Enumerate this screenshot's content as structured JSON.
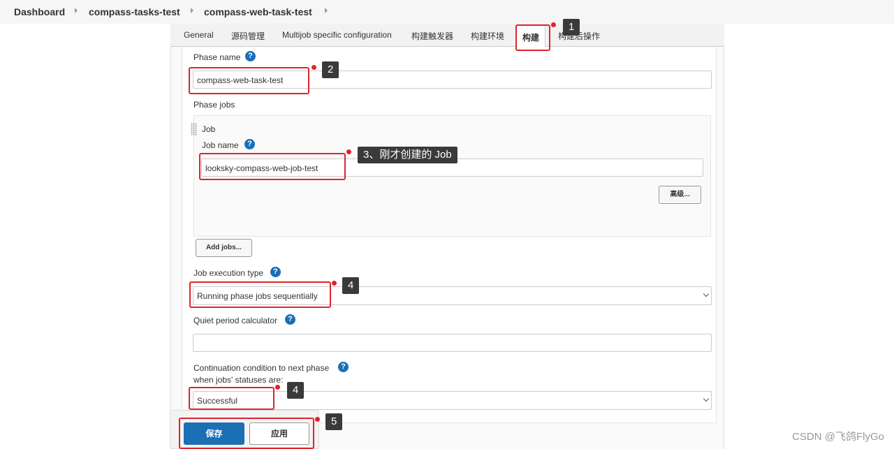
{
  "breadcrumb": [
    "Dashboard",
    "compass-tasks-test",
    "compass-web-task-test"
  ],
  "tabs": [
    "General",
    "源码管理",
    "Multijob specific configuration",
    "构建触发器",
    "构建环境",
    "构建",
    "构建后操作"
  ],
  "active_tab": "构建",
  "form": {
    "phase_name_label": "Phase name",
    "phase_name_value": "compass-web-task-test",
    "phase_jobs_label": "Phase jobs",
    "job_header": "Job",
    "job_name_label": "Job name",
    "job_name_value": "looksky-compass-web-job-test",
    "advanced_button": "高级...",
    "add_jobs_button": "Add jobs...",
    "exec_type_label": "Job execution type",
    "exec_type_value": "Running phase jobs sequentially",
    "quiet_period_label": "Quiet period calculator",
    "quiet_period_value": "",
    "continuation_label_line1": "Continuation condition to next phase",
    "continuation_label_line2": "when jobs' statuses are:",
    "continuation_value": "Successful",
    "help_glyph": "?"
  },
  "buttons": {
    "save": "保存",
    "apply": "应用"
  },
  "callouts": [
    "1",
    "2",
    "3、刚才创建的 Job",
    "4",
    "4",
    "5"
  ],
  "watermark": "CSDN @飞鸽FlyGo",
  "colors": {
    "accent": "#1a6fb5",
    "highlight": "#e0232e"
  }
}
